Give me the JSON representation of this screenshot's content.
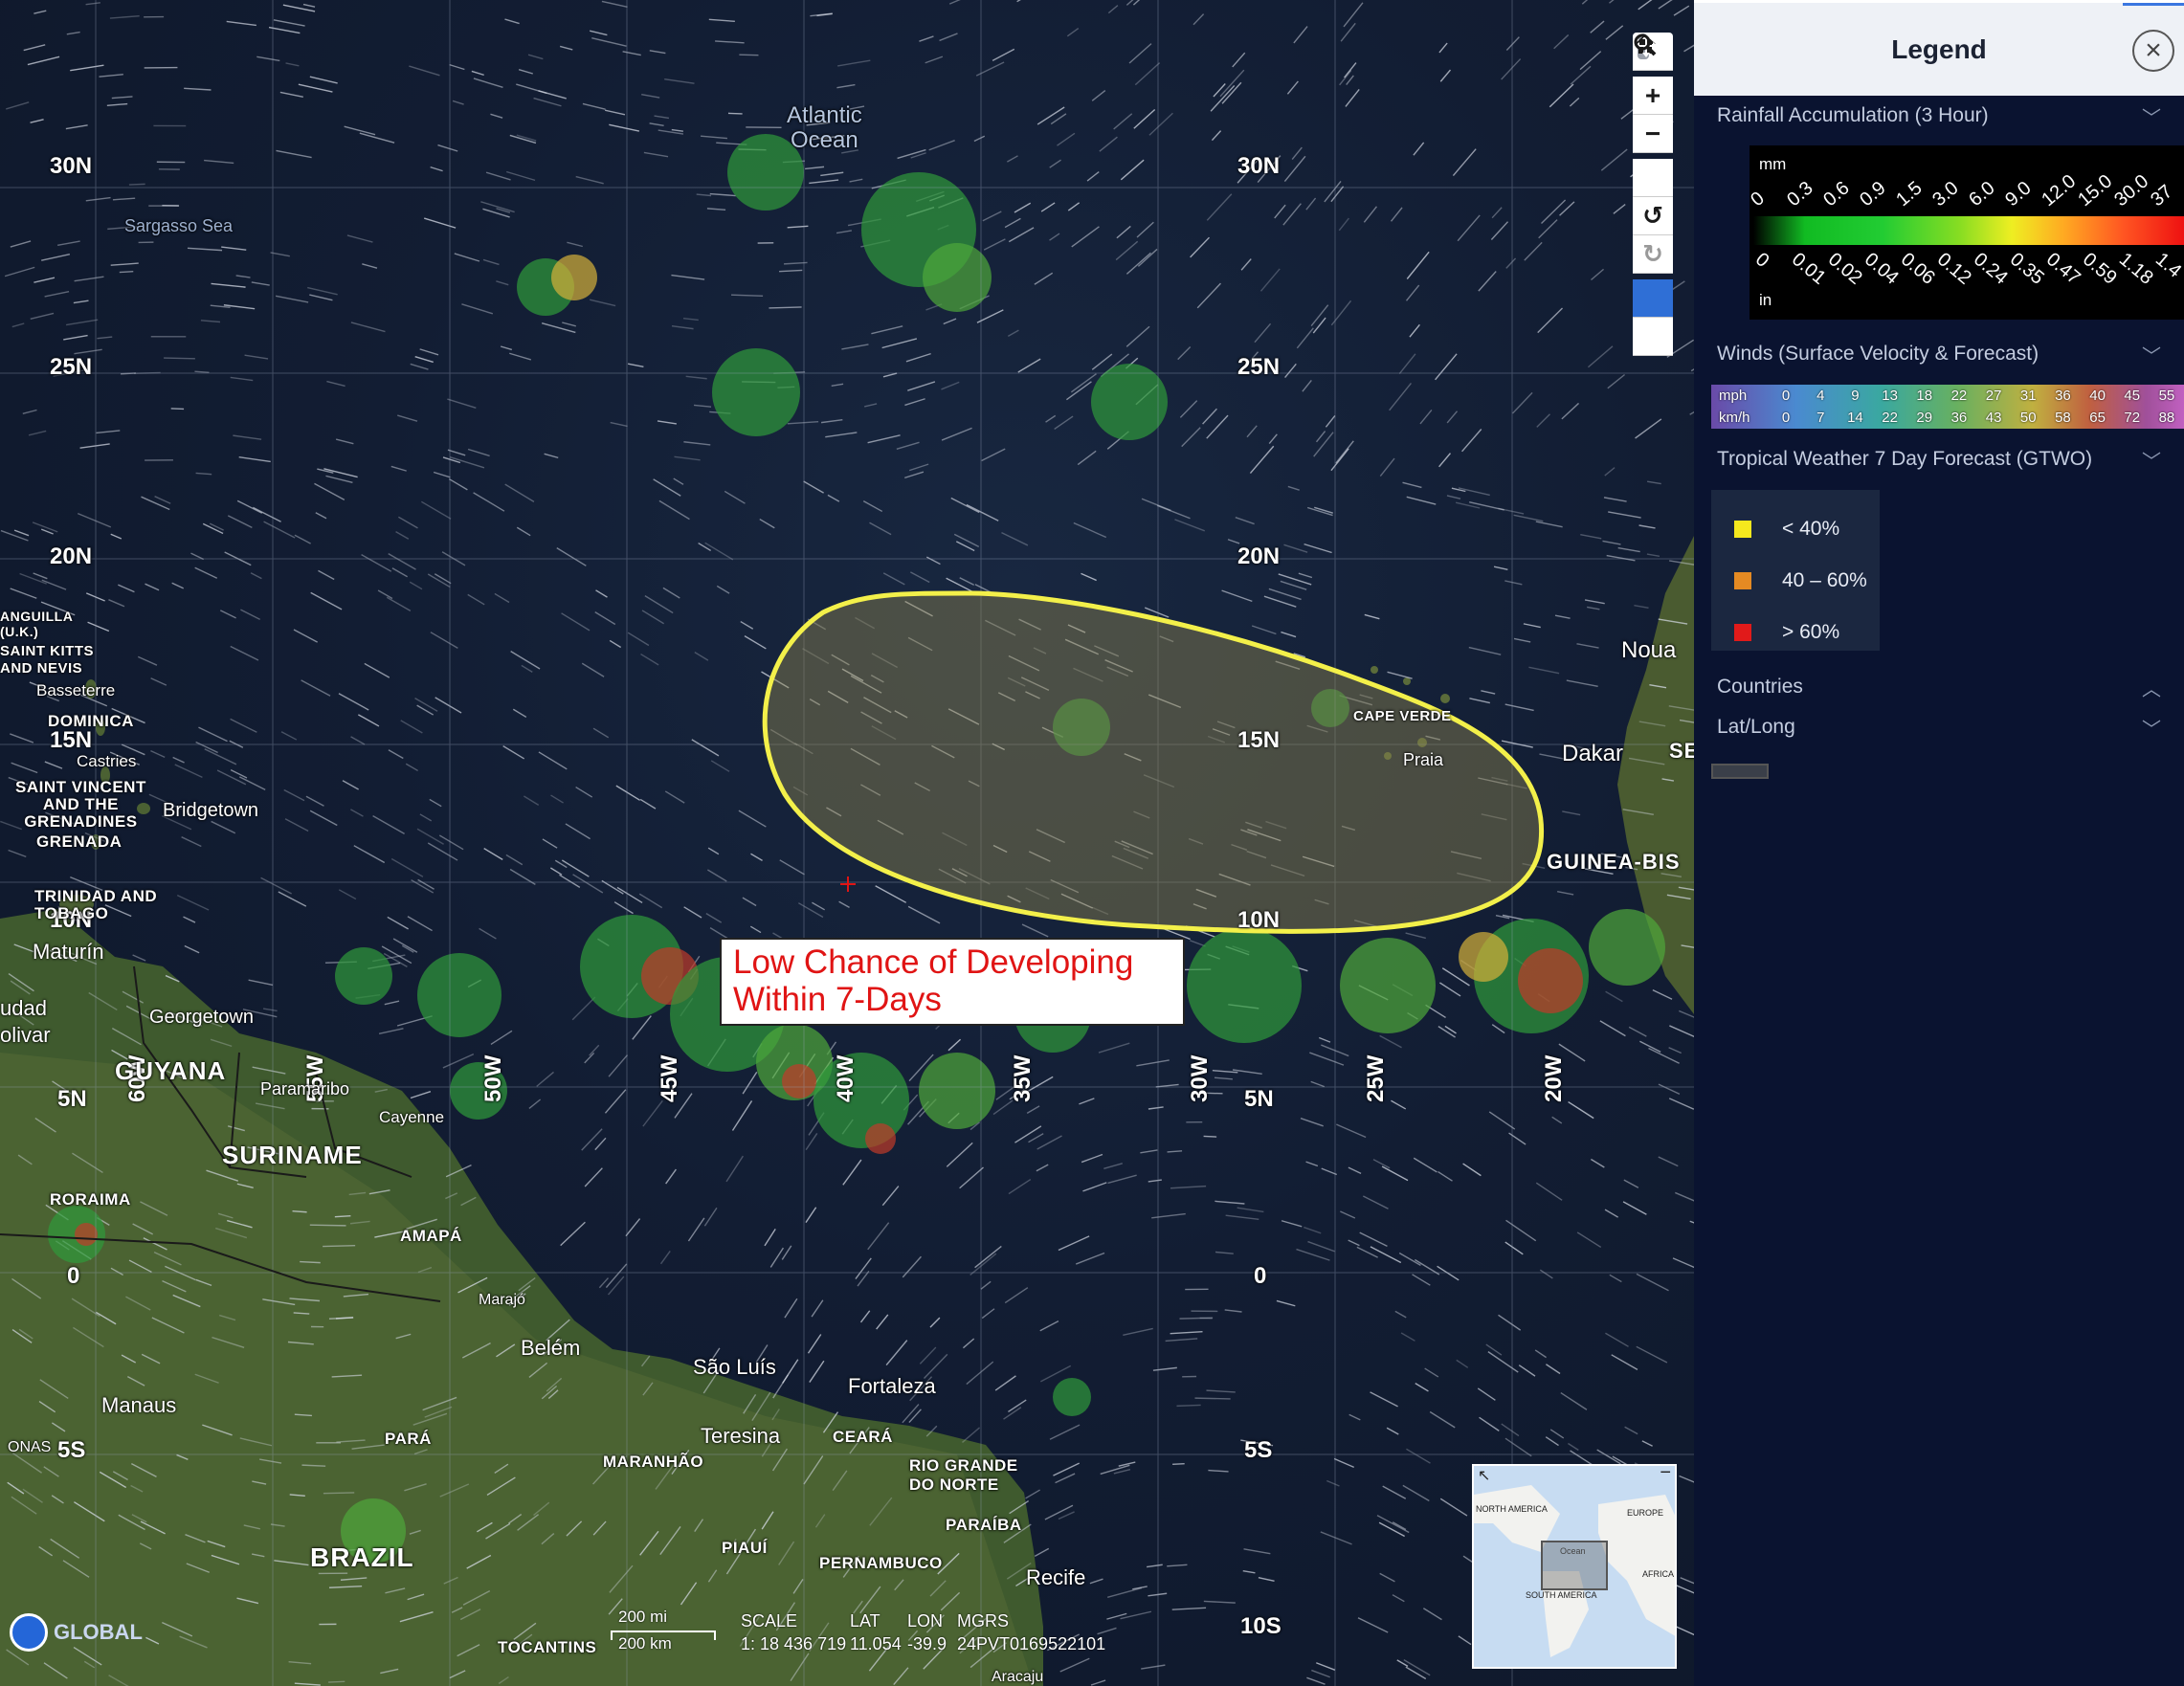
{
  "map": {
    "ocean_label": [
      "Atlantic",
      "Ocean"
    ],
    "sea_label": "Sargasso Sea",
    "lat_labels_left": [
      "30N",
      "25N",
      "20N",
      "15N",
      "10N",
      "5N",
      "0",
      "5S"
    ],
    "lat_labels_right": [
      "30N",
      "25N",
      "20N",
      "15N",
      "10N",
      "5N",
      "0",
      "5S",
      "10S"
    ],
    "lon_labels": [
      "60W",
      "55W",
      "50W",
      "45W",
      "40W",
      "35W",
      "30W",
      "25W",
      "20W"
    ],
    "places": {
      "anguilla": [
        "ANGUILLA",
        "(U.K.)"
      ],
      "saint_kitts": [
        "SAINT KITTS",
        "AND NEVIS"
      ],
      "basseterre": "Basseterre",
      "dominica": "DOMINICA",
      "castries": "Castries",
      "saint_vincent": [
        "SAINT VINCENT",
        "AND THE",
        "GRENADINES"
      ],
      "grenada": "GRENADA",
      "bridgetown": "Bridgetown",
      "trinidad": [
        "TRINIDAD AND",
        "TOBAGO"
      ],
      "maturin": "Maturín",
      "ciudad_bolivar": [
        "udad",
        "olivar"
      ],
      "georgetown": "Georgetown",
      "guyana": "GUYANA",
      "paramaribo": "Paramaribo",
      "cayenne": "Cayenne",
      "suriname": "SURINAME",
      "roraima": "RORAIMA",
      "amapa": "AMAPÁ",
      "marajo": "Marajó",
      "belem": "Belém",
      "manaus": "Manaus",
      "sao_luis": "São Luís",
      "fortaleza": "Fortaleza",
      "teresina": "Teresina",
      "ceara": "CEARÁ",
      "maranhao": "MARANHÃO",
      "para": "PARÁ",
      "brazil": "BRAZIL",
      "rio_grande": [
        "RIO GRANDE",
        "DO NORTE"
      ],
      "paraiba": "PARAÍBA",
      "piaui": "PIAUÍ",
      "pernambuco": "PERNAMBUCO",
      "recife": "Recife",
      "tocantins": "TOCANTINS",
      "cape_verde": "CAPE VERDE",
      "praia": "Praia",
      "nouakchott": "Noua",
      "dakar": "Dakar",
      "senegal": "SE",
      "guinea_bissau": "GUINEA-BIS",
      "amazonas": "ONAS",
      "aracaju": "Aracaju"
    },
    "annotation": [
      "Low Chance of Developing",
      "Within 7-Days"
    ],
    "logo_text": "GLOBAL",
    "scale": {
      "mi": "200 mi",
      "km": "200 km",
      "scale_label": "SCALE",
      "scale_value": "1: 18 436 719",
      "lat_label": "LAT",
      "lat_value": "11.054",
      "lon_label": "LON",
      "lon_value": "-39.9",
      "mgrs_label": "MGRS",
      "mgrs_value": "24PVT0169522101"
    },
    "overview": {
      "north_america": "NORTH AMERICA",
      "europe": "EUROPE",
      "africa": "AFRICA",
      "south_america": "SOUTH AMERICA",
      "ocean": "Ocean"
    },
    "tools": [
      "person-icon",
      "zoom-in-icon",
      "zoom-out-icon",
      "home-icon",
      "rotate-left-icon",
      "rotate-right-icon",
      "pan-icon",
      "zoom-box-icon"
    ],
    "colors": {
      "outlook_yellow": "#f3f04a",
      "annotation_red": "#e01414",
      "active_tool": "#2f6fd6"
    }
  },
  "legend": {
    "title": "Legend",
    "sections": {
      "rainfall": "Rainfall Accumulation (3 Hour)",
      "winds": "Winds (Surface Velocity & Forecast)",
      "gtwo": "Tropical Weather 7 Day Forecast (GTWO)",
      "countries": "Countries",
      "latlong": "Lat/Long"
    },
    "rain": {
      "unit_top": "mm",
      "unit_bottom": "in",
      "mm_ticks": [
        "0",
        "0.3",
        "0.6",
        "0.9",
        "1.5",
        "3.0",
        "6.0",
        "9.0",
        "12.0",
        "15.0",
        "30.0",
        "37"
      ],
      "in_ticks": [
        "0",
        "0.01",
        "0.02",
        "0.04",
        "0.06",
        "0.12",
        "0.24",
        "0.35",
        "0.47",
        "0.59",
        "1.18",
        "1.4"
      ]
    },
    "wind": {
      "mph_label": "mph",
      "kmh_label": "km/h",
      "mph": [
        "0",
        "4",
        "9",
        "13",
        "18",
        "22",
        "27",
        "31",
        "36",
        "40",
        "45",
        "55"
      ],
      "kmh": [
        "0",
        "7",
        "14",
        "22",
        "29",
        "36",
        "43",
        "50",
        "58",
        "65",
        "72",
        "88"
      ]
    },
    "gtwo": [
      {
        "label": "< 40%",
        "color": "#f5e81e"
      },
      {
        "label": "40 – 60%",
        "color": "#e58a23"
      },
      {
        "label": "> 60%",
        "color": "#e11a1a"
      }
    ]
  }
}
